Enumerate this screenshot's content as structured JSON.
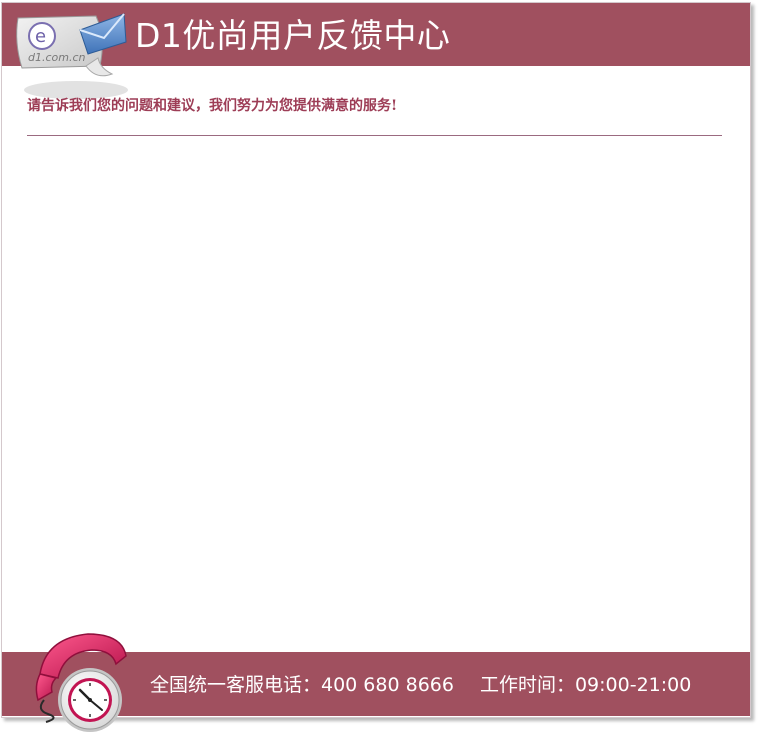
{
  "header": {
    "title": "D1优尚用户反馈中心",
    "logo_icon": "email-envelope-icon",
    "logo_text": "d1.com.cn"
  },
  "main": {
    "tagline": "请告诉我们您的问题和建议，我们努力为您提供满意的服务!"
  },
  "footer": {
    "hotline": "全国统一客服电话：400 680 8666",
    "hours": "工作时间：09:00-21:00",
    "phone_icon": "telephone-clock-icon"
  },
  "colors": {
    "brand": "#a0505f",
    "tagline": "#9d3d56",
    "divider": "#9b6a80"
  }
}
